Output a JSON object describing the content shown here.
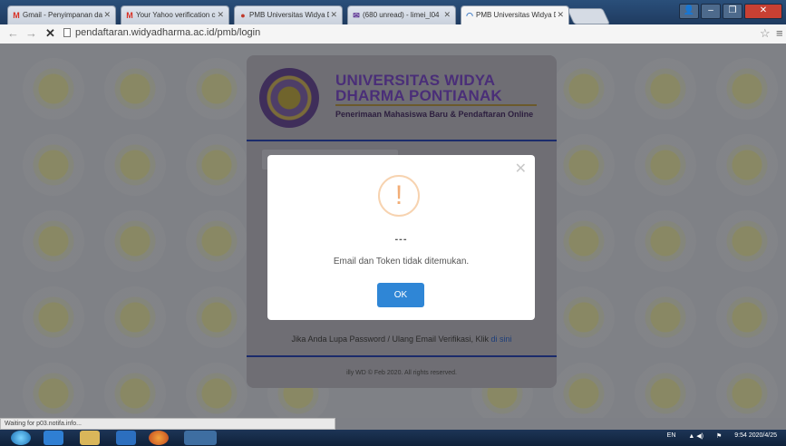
{
  "browser": {
    "tabs": [
      {
        "icon": "gmail-icon",
        "title": "Gmail - Penyimpanan da"
      },
      {
        "icon": "gmail-icon",
        "title": "Your Yahoo verification c"
      },
      {
        "icon": "pmb-icon",
        "title": "PMB Universitas Widya D"
      },
      {
        "icon": "yahoo-mail-icon",
        "title": "(680 unread) - limei_l04"
      },
      {
        "icon": "loading-icon",
        "title": "PMB Universitas Widya D"
      }
    ],
    "url": "pendaftaran.widyadharma.ac.id/pmb/login"
  },
  "header": {
    "university_name": "UNIVERSITAS WIDYA DHARMA PONTIANAK",
    "subtitle": "Penerimaan Mahasiswa Baru & Pendaftaran Online"
  },
  "footer": {
    "forgot_text": "Jika Anda Lupa Password / Ulang Email Verifikasi, Klik ",
    "forgot_link": "di sini",
    "copyright": "illy WD © Feb 2020. All rights reserved."
  },
  "modal": {
    "title": "---",
    "message": "Email dan Token tidak ditemukan.",
    "ok_label": "OK",
    "icon_glyph": "!"
  },
  "status_bar": "Waiting for p03.notifa.info...",
  "taskbar": {
    "language": "EN",
    "time": "9:54",
    "date": "2020/4/25"
  }
}
